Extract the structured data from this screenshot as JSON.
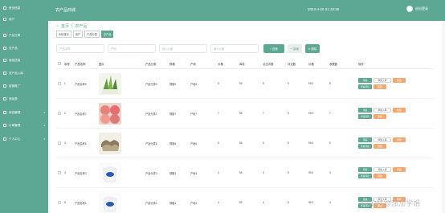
{
  "header": {
    "title": "农产品商城",
    "datetime": "2024-4-25 21:15:38",
    "user": "退出登录"
  },
  "sidebar": {
    "items": [
      {
        "label": "首页信息"
      },
      {
        "label": "用户"
      },
      {
        "label": "产品分类"
      },
      {
        "label": "农产品"
      },
      {
        "label": "商品信息"
      },
      {
        "label": "农产品入库"
      },
      {
        "label": "促销推广"
      },
      {
        "label": "商品类"
      },
      {
        "label": "系统管理",
        "has_arrow": true
      },
      {
        "label": "订单管理",
        "has_arrow": true
      },
      {
        "label": "个人中心",
        "has_arrow": true
      }
    ]
  },
  "breadcrumb": {
    "home": "首页",
    "sep": "/",
    "current": "农产品"
  },
  "tags": [
    {
      "label": "系统首页",
      "active": false
    },
    {
      "label": "用户",
      "active": false
    },
    {
      "label": "产品分类",
      "active": false
    },
    {
      "label": "农产品",
      "active": true
    }
  ],
  "search": {
    "placeholders": [
      "产品名称",
      "产地",
      "最小价格",
      "最大价格"
    ],
    "search_button": "查询",
    "add_button": "新增",
    "delete_button": "删除"
  },
  "table": {
    "headers": [
      "",
      "序号",
      "产品名称",
      "图片",
      "产品分类",
      "规格",
      "产地",
      "价格",
      "库存",
      "点击次数",
      "评论数",
      "价格",
      "收藏数",
      "操作"
    ],
    "rows": [
      {
        "no": "1",
        "name": "产品名称5",
        "cat": "产品分类5",
        "spec": "规格5",
        "origin": "产地5",
        "price": "5",
        "stock": "55",
        "clicks": "5",
        "comments": "5",
        "price2": "99.0",
        "fav": "5",
        "img": "greens"
      },
      {
        "no": "2",
        "name": "产品名称7",
        "cat": "产品分类7",
        "spec": "规格7",
        "origin": "产地7",
        "price": "7",
        "stock": "55",
        "clicks": "7",
        "comments": "5",
        "price2": "99.0",
        "fav": "7",
        "img": "peach"
      },
      {
        "no": "3",
        "name": "产品名称6",
        "cat": "产品分类6",
        "spec": "规格6",
        "origin": "产地6",
        "price": "6",
        "stock": "55",
        "clicks": "6",
        "comments": "5",
        "price2": "99.0",
        "fav": "6",
        "img": "mushroom"
      },
      {
        "no": "4",
        "name": "产品名称3",
        "cat": "产品分类3",
        "spec": "规格3",
        "origin": "产地3",
        "price": "3",
        "stock": "55",
        "clicks": "3",
        "comments": "5",
        "price2": "99.0",
        "fav": "3",
        "img": "yogurt"
      },
      {
        "no": "5",
        "name": "产品名称4",
        "cat": "产品分类4",
        "spec": "规格4",
        "origin": "产地4",
        "price": "4",
        "stock": "55",
        "clicks": "4",
        "comments": "5",
        "price2": "99.0",
        "fav": "4",
        "img": "yogurt"
      }
    ],
    "ops": {
      "view": "查看",
      "cart": "添加入库",
      "edit": "修改",
      "review": "查看评论",
      "del": "删除"
    }
  },
  "watermark": "CSDN @茄茄学姐"
}
